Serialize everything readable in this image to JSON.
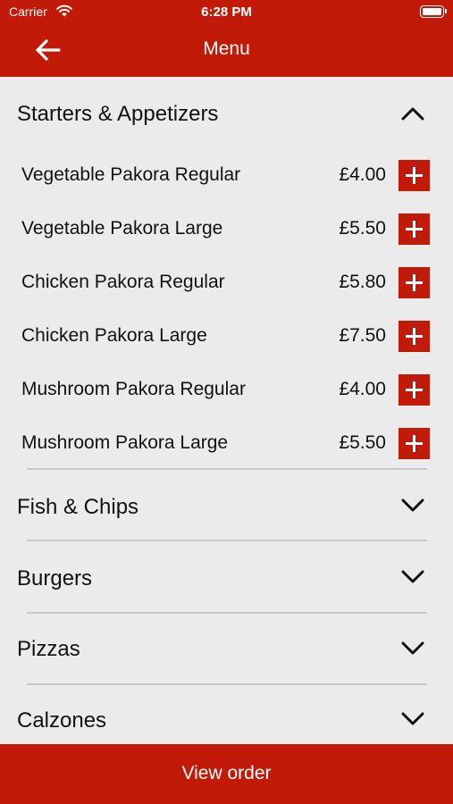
{
  "status_bar": {
    "carrier": "Carrier",
    "time": "6:28 PM"
  },
  "header": {
    "title": "Menu",
    "back_icon": "arrow-left-icon"
  },
  "colors": {
    "brand": "#c11a08",
    "background": "#ebebeb"
  },
  "sections": [
    {
      "title": "Starters & Appetizers",
      "expanded": true,
      "items": [
        {
          "name": "Vegetable Pakora Regular",
          "price": "£4.00"
        },
        {
          "name": "Vegetable Pakora Large",
          "price": "£5.50"
        },
        {
          "name": "Chicken Pakora Regular",
          "price": "£5.80"
        },
        {
          "name": "Chicken Pakora Large",
          "price": "£7.50"
        },
        {
          "name": "Mushroom Pakora Regular",
          "price": "£4.00"
        },
        {
          "name": "Mushroom Pakora Large",
          "price": "£5.50"
        }
      ]
    },
    {
      "title": "Fish & Chips",
      "expanded": false
    },
    {
      "title": "Burgers",
      "expanded": false
    },
    {
      "title": "Pizzas",
      "expanded": false
    },
    {
      "title": "Calzones",
      "expanded": false
    }
  ],
  "footer": {
    "label": "View order"
  }
}
